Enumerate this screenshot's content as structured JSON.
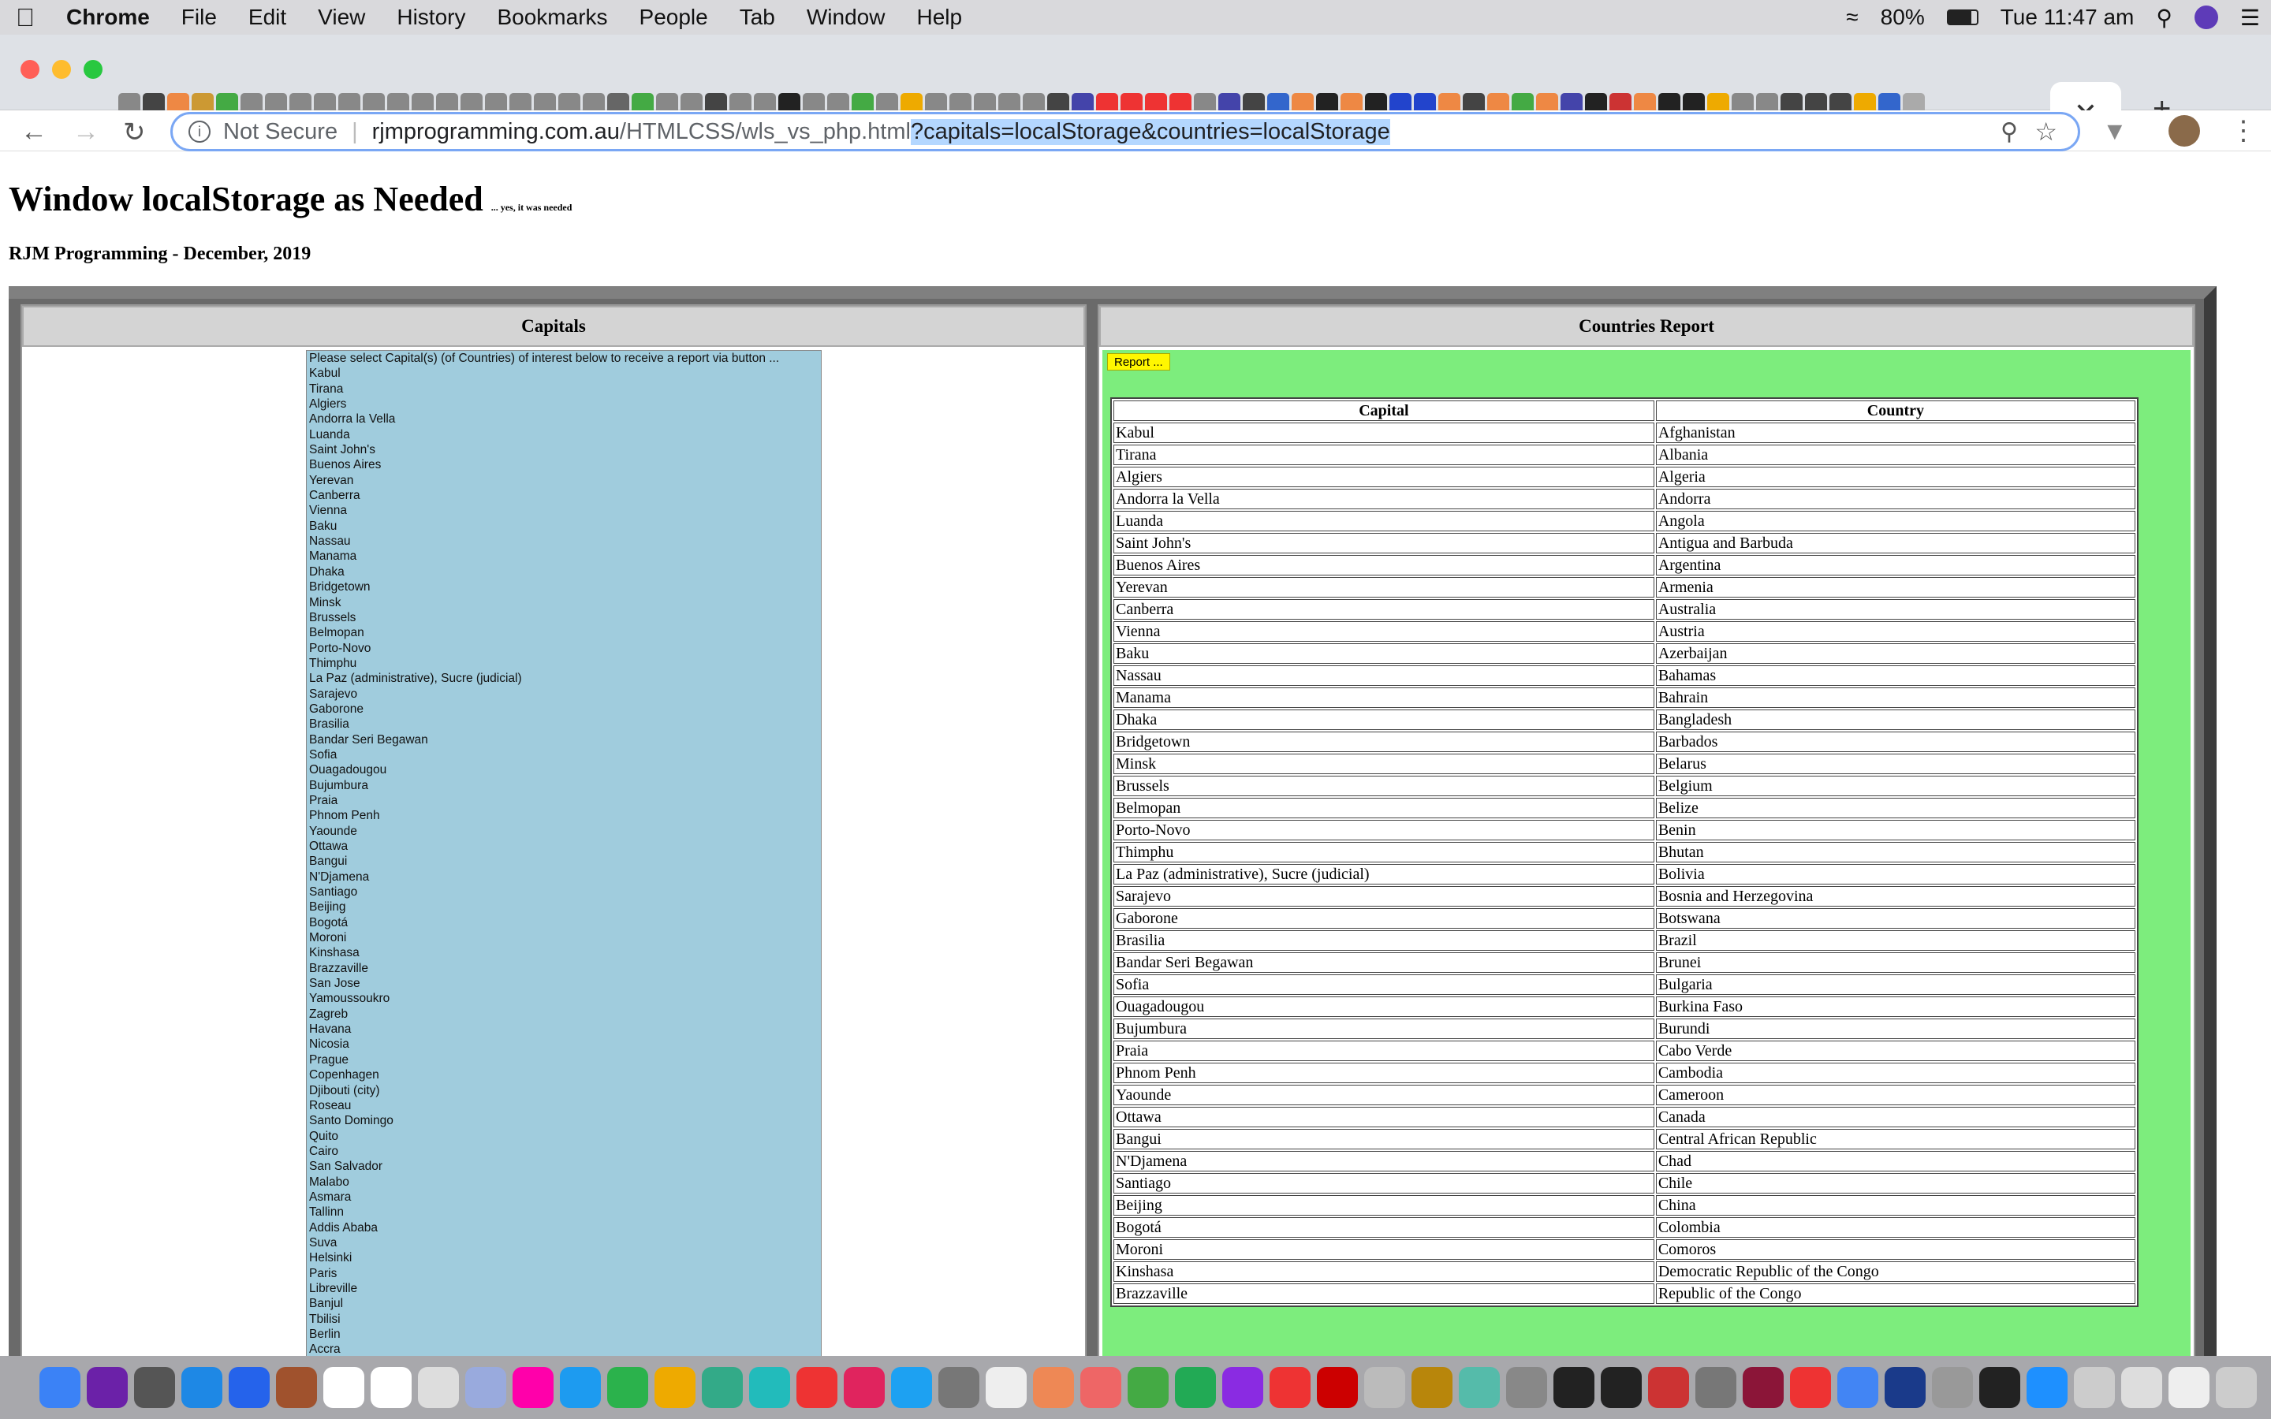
{
  "menubar": {
    "app": "Chrome",
    "items": [
      "File",
      "Edit",
      "View",
      "History",
      "Bookmarks",
      "People",
      "Tab",
      "Window",
      "Help"
    ],
    "battery": "80%",
    "clock": "Tue 11:47 am"
  },
  "tabs": {
    "active_close": "✕",
    "new_tab": "+"
  },
  "tab_favicons": [
    "#888",
    "#444",
    "#e84",
    "#c93",
    "#4a4",
    "#888",
    "#888",
    "#888",
    "#888",
    "#888",
    "#888",
    "#888",
    "#888",
    "#888",
    "#888",
    "#888",
    "#888",
    "#888",
    "#888",
    "#888",
    "#666",
    "#4a4",
    "#888",
    "#888",
    "#444",
    "#888",
    "#888",
    "#222",
    "#888",
    "#888",
    "#4a4",
    "#888",
    "#ea0",
    "#888",
    "#888",
    "#888",
    "#888",
    "#888",
    "#444",
    "#44a",
    "#e33",
    "#e33",
    "#e33",
    "#e33",
    "#888",
    "#44a",
    "#444",
    "#36c",
    "#e84",
    "#222",
    "#e84",
    "#222",
    "#24c",
    "#24c",
    "#e84",
    "#444",
    "#e84",
    "#4a4",
    "#e84",
    "#44a",
    "#222",
    "#c33",
    "#e84",
    "#222",
    "#222",
    "#ea0",
    "#888",
    "#888",
    "#444",
    "#444",
    "#444",
    "#ea0",
    "#36c",
    "#aaa"
  ],
  "address": {
    "not_secure": "Not Secure",
    "host": "rjmprogramming.com.au",
    "path": "/HTMLCSS/wls_vs_php.html",
    "query": "?capitals=localStorage&countries=localStorage"
  },
  "page": {
    "title": "Window localStorage as Needed",
    "subtitle": "... yes, it was needed",
    "byline": "RJM Programming - December, 2019",
    "left_header": "Capitals",
    "right_header": "Countries Report",
    "report_button": "Report ...",
    "col_capital": "Capital",
    "col_country": "Country",
    "select_prompt": "Please select Capital(s) (of Countries) of interest below to receive a report via button ...",
    "capitals_list": [
      "Kabul",
      "Tirana",
      "Algiers",
      "Andorra la Vella",
      "Luanda",
      "Saint John's",
      "Buenos Aires",
      "Yerevan",
      "Canberra",
      "Vienna",
      "Baku",
      "Nassau",
      "Manama",
      "Dhaka",
      "Bridgetown",
      "Minsk",
      "Brussels",
      "Belmopan",
      "Porto-Novo",
      "Thimphu",
      "La Paz (administrative), Sucre (judicial)",
      "Sarajevo",
      "Gaborone",
      "Brasilia",
      "Bandar Seri Begawan",
      "Sofia",
      "Ouagadougou",
      "Bujumbura",
      "Praia",
      "Phnom Penh",
      "Yaounde",
      "Ottawa",
      "Bangui",
      "N'Djamena",
      "Santiago",
      "Beijing",
      "Bogotá",
      "Moroni",
      "Kinshasa",
      "Brazzaville",
      "San Jose",
      "Yamoussoukro",
      "Zagreb",
      "Havana",
      "Nicosia",
      "Prague",
      "Copenhagen",
      "Djibouti (city)",
      "Roseau",
      "Santo Domingo",
      "Quito",
      "Cairo",
      "San Salvador",
      "Malabo",
      "Asmara",
      "Tallinn",
      "Addis Ababa",
      "Suva",
      "Helsinki",
      "Paris",
      "Libreville",
      "Banjul",
      "Tbilisi",
      "Berlin",
      "Accra"
    ],
    "report_rows": [
      [
        "Kabul",
        "Afghanistan"
      ],
      [
        "Tirana",
        "Albania"
      ],
      [
        "Algiers",
        "Algeria"
      ],
      [
        "Andorra la Vella",
        "Andorra"
      ],
      [
        "Luanda",
        "Angola"
      ],
      [
        "Saint John's",
        "Antigua and Barbuda"
      ],
      [
        "Buenos Aires",
        "Argentina"
      ],
      [
        "Yerevan",
        "Armenia"
      ],
      [
        "Canberra",
        "Australia"
      ],
      [
        "Vienna",
        "Austria"
      ],
      [
        "Baku",
        "Azerbaijan"
      ],
      [
        "Nassau",
        "Bahamas"
      ],
      [
        "Manama",
        "Bahrain"
      ],
      [
        "Dhaka",
        "Bangladesh"
      ],
      [
        "Bridgetown",
        "Barbados"
      ],
      [
        "Minsk",
        "Belarus"
      ],
      [
        "Brussels",
        "Belgium"
      ],
      [
        "Belmopan",
        "Belize"
      ],
      [
        "Porto-Novo",
        "Benin"
      ],
      [
        "Thimphu",
        "Bhutan"
      ],
      [
        "La Paz (administrative), Sucre (judicial)",
        "Bolivia"
      ],
      [
        "Sarajevo",
        "Bosnia and Herzegovina"
      ],
      [
        "Gaborone",
        "Botswana"
      ],
      [
        "Brasilia",
        "Brazil"
      ],
      [
        "Bandar Seri Begawan",
        "Brunei"
      ],
      [
        "Sofia",
        "Bulgaria"
      ],
      [
        "Ouagadougou",
        "Burkina Faso"
      ],
      [
        "Bujumbura",
        "Burundi"
      ],
      [
        "Praia",
        "Cabo Verde"
      ],
      [
        "Phnom Penh",
        "Cambodia"
      ],
      [
        "Yaounde",
        "Cameroon"
      ],
      [
        "Ottawa",
        "Canada"
      ],
      [
        "Bangui",
        "Central African Republic"
      ],
      [
        "N'Djamena",
        "Chad"
      ],
      [
        "Santiago",
        "Chile"
      ],
      [
        "Beijing",
        "China"
      ],
      [
        "Bogotá",
        "Colombia"
      ],
      [
        "Moroni",
        "Comoros"
      ],
      [
        "Kinshasa",
        "Democratic Republic of the Congo"
      ],
      [
        "Brazzaville",
        "Republic of the Congo"
      ]
    ]
  },
  "dock_colors": [
    "#3b82f6",
    "#6b21a8",
    "#555",
    "#1e88e5",
    "#2563eb",
    "#a0522d",
    "#fff",
    "#fff",
    "#ddd",
    "#9ad",
    "#f0a",
    "#1d9bf0",
    "#2bb24c",
    "#ea0",
    "#3a8",
    "#2bb",
    "#e33",
    "#e0245e",
    "#1da1f2",
    "#777",
    "#eee",
    "#e85",
    "#e66",
    "#4a4",
    "#2a5",
    "#8a2be2",
    "#e33",
    "#c00",
    "#bbb",
    "#b8860b",
    "#5ba",
    "#888",
    "#222",
    "#222",
    "#c33",
    "#777",
    "#8b1538",
    "#e33",
    "#4285f4",
    "#1a3a8a",
    "#999",
    "#222",
    "#1e90ff",
    "#ccc",
    "#ddd",
    "#eee",
    "#ccc"
  ]
}
